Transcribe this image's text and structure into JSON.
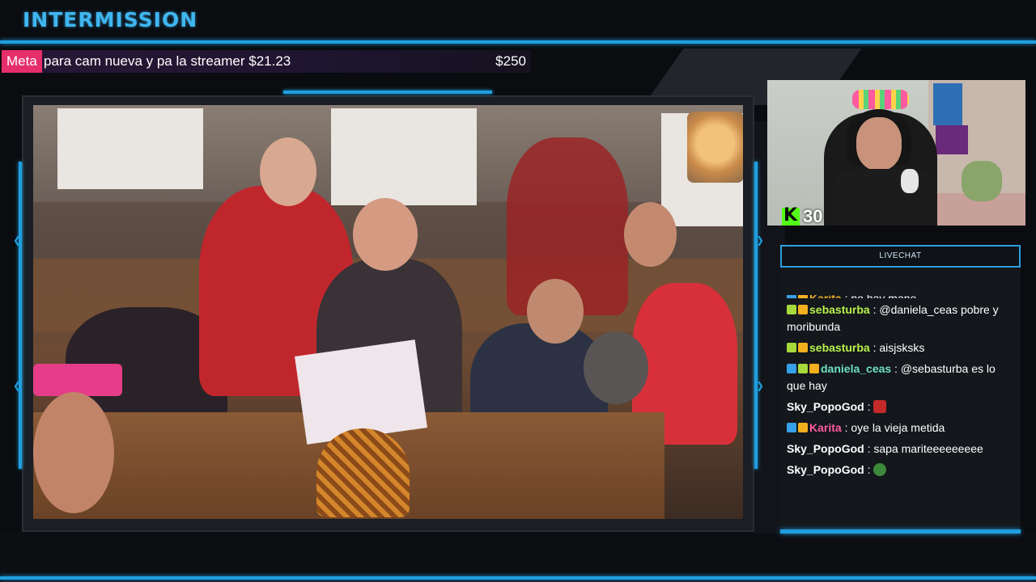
{
  "header": {
    "title": "INTERMISSION"
  },
  "goal": {
    "label": "Meta",
    "description": "para cam nueva y pa la streamer",
    "current": "$21.23",
    "target": "$250"
  },
  "webcam": {
    "platform_icon": "kick-icon",
    "viewer_count": "30"
  },
  "chat": {
    "title": "LIVECHAT",
    "messages": [
      {
        "user": "Karita",
        "text": "no hay mano",
        "user_color": "#f2b01e",
        "badges": [
          "arrow",
          "crown"
        ],
        "emote": ""
      },
      {
        "user": "sebasturba",
        "text": "@daniela_ceas pobre y moribunda",
        "user_color": "#b7f24a",
        "badges": [
          "cat",
          "crown"
        ],
        "emote": ""
      },
      {
        "user": "sebasturba",
        "text": "aisjsksks",
        "user_color": "#b7f24a",
        "badges": [
          "cat",
          "crown"
        ],
        "emote": ""
      },
      {
        "user": "daniela_ceas",
        "text": "@sebasturba es lo que hay",
        "user_color": "#6fe0c0",
        "badges": [
          "arrow",
          "cat",
          "crown"
        ],
        "emote": ""
      },
      {
        "user": "Sky_PopoGod",
        "text": "",
        "user_color": "#ffffff",
        "badges": [],
        "emote": "red-mask-emote"
      },
      {
        "user": "Karita",
        "text": "oye la vieja metida",
        "user_color": "#ff5aa0",
        "badges": [
          "arrow",
          "crown"
        ],
        "emote": ""
      },
      {
        "user": "Sky_PopoGod",
        "text": "sapa mariteeeeeeeee",
        "user_color": "#ffffff",
        "badges": [],
        "emote": ""
      },
      {
        "user": "Sky_PopoGod",
        "text": "",
        "user_color": "#ffffff",
        "badges": [],
        "emote": "frog-emote"
      }
    ]
  },
  "colors": {
    "accent": "#1f9fe0",
    "title": "#3fb6f0",
    "goal_label": "#e62e6b",
    "kick": "#53fc18"
  }
}
